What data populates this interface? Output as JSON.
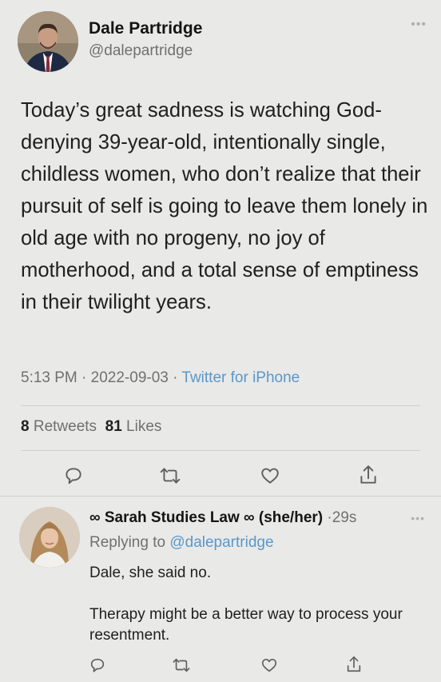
{
  "tweet": {
    "author_name": "Dale Partridge",
    "author_handle": "@dalepartridge",
    "more_icon": "more-dots-icon",
    "text": "Today’s great sadness is watching God-denying 39-year-old, intentionally single, childless women, who don’t realize that their pursuit of self is going to leave them lonely in old age with no progeny, no joy of motherhood, and a total sense of emptiness in their twilight years.",
    "time": "5:13 PM",
    "date": "2022-09-03",
    "separator": "·",
    "source": "Twitter for iPhone",
    "retweets_count": "8",
    "retweets_label": "Retweets",
    "likes_count": "81",
    "likes_label": "Likes",
    "actions": [
      "reply-icon",
      "retweet-icon",
      "like-icon",
      "share-icon"
    ]
  },
  "reply": {
    "author_name": "∞ Sarah Studies Law ∞ (she/her)",
    "separator": "·",
    "time": "29s",
    "replying_prefix": "Replying to",
    "replying_to": "@dalepartridge",
    "text_line1": "Dale, she said no.",
    "text_line2": "Therapy might be a better way to process your resentment.",
    "actions": [
      "reply-icon",
      "retweet-icon",
      "like-icon",
      "share-icon"
    ]
  },
  "colors": {
    "background": "#e9e9e7",
    "link": "#5a97c9",
    "muted": "#707070",
    "text": "#1f1f1f"
  }
}
